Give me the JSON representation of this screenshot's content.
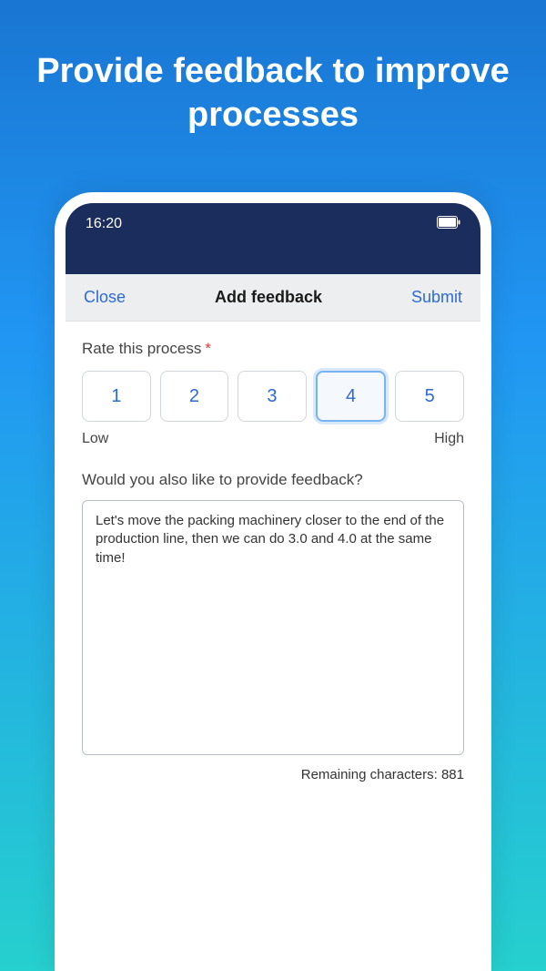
{
  "hero": {
    "title": "Provide feedback to improve processes"
  },
  "statusBar": {
    "time": "16:20"
  },
  "header": {
    "close": "Close",
    "title": "Add feedback",
    "submit": "Submit"
  },
  "rating": {
    "label": "Rate this process",
    "required": "*",
    "options": {
      "o1": "1",
      "o2": "2",
      "o3": "3",
      "o4": "4",
      "o5": "5"
    },
    "low": "Low",
    "high": "High"
  },
  "feedback": {
    "prompt": "Would you also like to provide feedback?",
    "value": "Let's move the packing machinery closer to the end of the production line, then we can do 3.0 and 4.0 at the same time!",
    "remaining_label": "Remaining characters: 881"
  }
}
